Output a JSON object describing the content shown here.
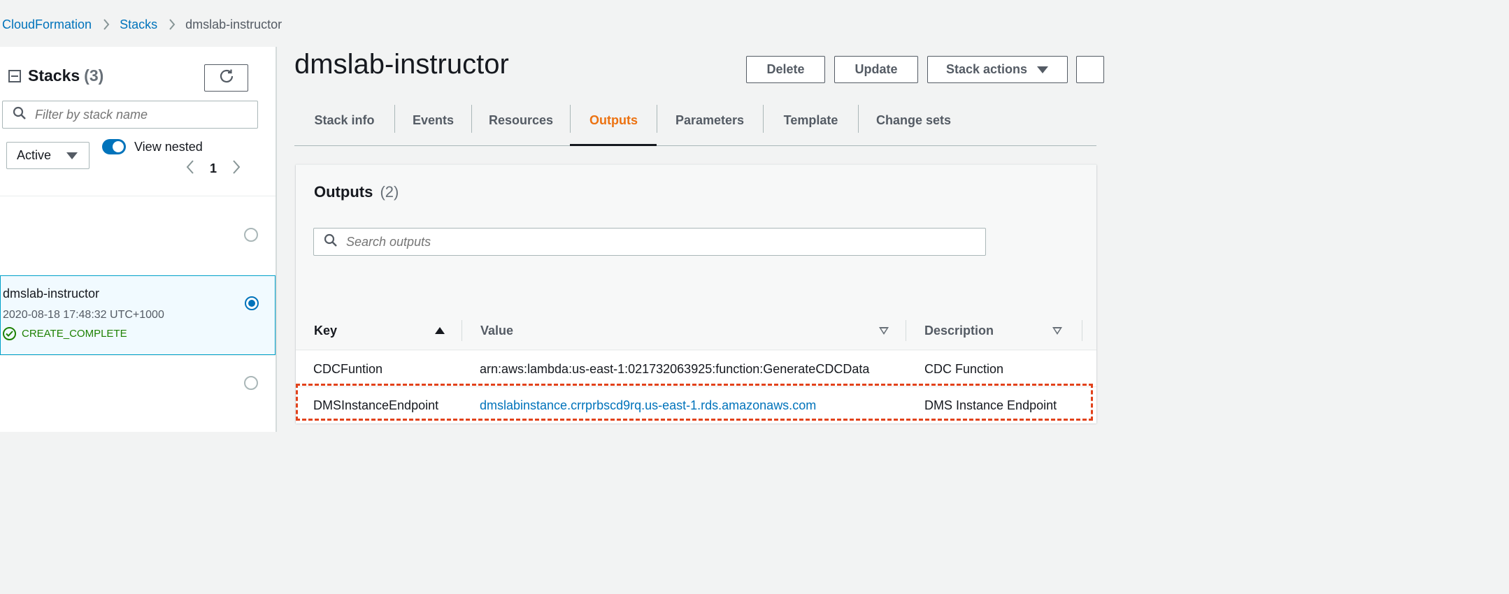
{
  "breadcrumb": {
    "items": [
      "CloudFormation",
      "Stacks"
    ],
    "current": "dmslab-instructor"
  },
  "sidebar": {
    "title": "Stacks",
    "count": "(3)",
    "filter_placeholder": "Filter by stack name",
    "status_filter": "Active",
    "view_nested_label": "View nested",
    "view_nested_on": true,
    "page": "1",
    "stacks": [
      {
        "name": "",
        "time": "",
        "status": "",
        "selected": false
      },
      {
        "name": "dmslab-instructor",
        "time": "2020-08-18 17:48:32 UTC+1000",
        "status": "CREATE_COMPLETE",
        "selected": true
      },
      {
        "name": "",
        "time": "",
        "status": "",
        "selected": false
      }
    ]
  },
  "main": {
    "title": "dmslab-instructor",
    "buttons": {
      "delete": "Delete",
      "update": "Update",
      "stack_actions": "Stack actions"
    },
    "tabs": [
      "Stack info",
      "Events",
      "Resources",
      "Outputs",
      "Parameters",
      "Template",
      "Change sets"
    ],
    "active_tab": "Outputs"
  },
  "outputs": {
    "title": "Outputs",
    "count": "(2)",
    "search_placeholder": "Search outputs",
    "columns": {
      "key": "Key",
      "value": "Value",
      "description": "Description"
    },
    "rows": [
      {
        "key": "CDCFuntion",
        "value": "arn:aws:lambda:us-east-1:021732063925:function:GenerateCDCData",
        "description": "CDC Function"
      },
      {
        "key": "DMSInstanceEndpoint",
        "value": "dmslabinstance.crrprbscd9rq.us-east-1.rds.amazonaws.com",
        "description": "DMS Instance Endpoint"
      }
    ]
  },
  "colors": {
    "link": "#0073bb",
    "active_tab": "#ec7211",
    "success": "#1d8102",
    "highlight": "#e2421b"
  }
}
